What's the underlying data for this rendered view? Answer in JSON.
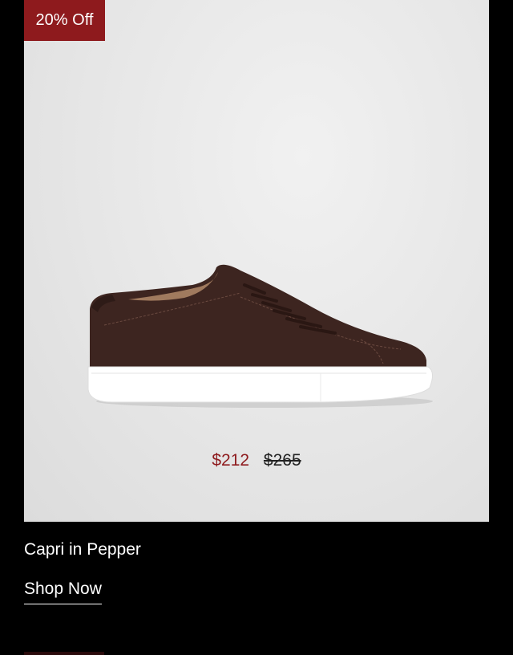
{
  "product_card": {
    "badge": "20% Off",
    "image_alt": "brown suede low-top sneaker",
    "sale_price": "$212",
    "original_price": "$265",
    "name": "Capri in Pepper",
    "cta_label": "Shop Now"
  },
  "colors": {
    "page_background": "#000000",
    "badge_background": "#8e1a1d",
    "sale_price": "#8e1a1d",
    "shoe_upper": "#3d2520",
    "sole": "#ffffff"
  }
}
